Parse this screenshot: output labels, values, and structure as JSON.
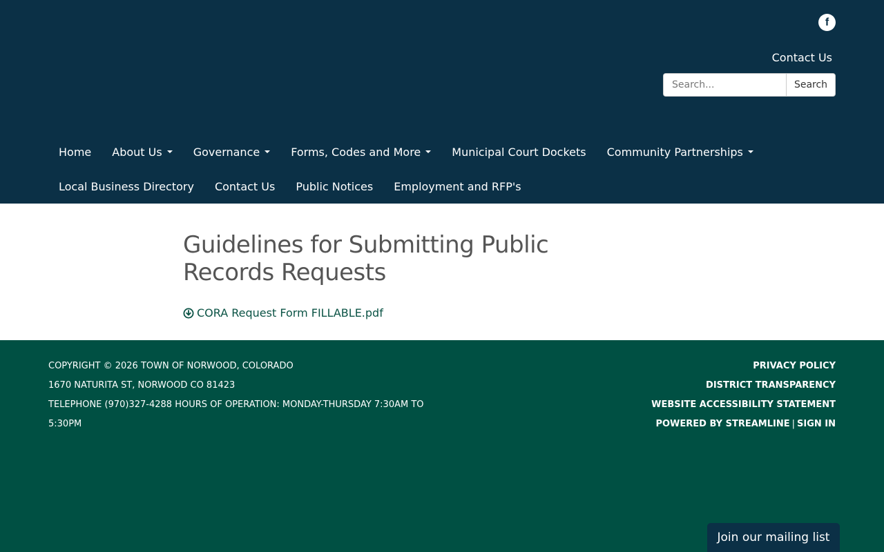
{
  "header": {
    "social": {
      "icon": "facebook-icon",
      "glyph": "f"
    },
    "contact_link": "Contact Us",
    "search": {
      "placeholder": "Search...",
      "button_label": "Search"
    }
  },
  "nav": {
    "row1": [
      {
        "label": "Home",
        "dropdown": false
      },
      {
        "label": "About Us",
        "dropdown": true
      },
      {
        "label": "Governance",
        "dropdown": true
      },
      {
        "label": "Forms, Codes and More",
        "dropdown": true
      },
      {
        "label": "Municipal Court Dockets",
        "dropdown": false
      },
      {
        "label": "Community Partnerships",
        "dropdown": true
      }
    ],
    "row2": [
      {
        "label": "Local Business Directory",
        "dropdown": false
      },
      {
        "label": "Contact Us",
        "dropdown": false
      },
      {
        "label": "Public Notices",
        "dropdown": false
      },
      {
        "label": "Employment and RFP's",
        "dropdown": false
      }
    ]
  },
  "main": {
    "title": "Guidelines for Submitting Public Records Requests",
    "attachment": {
      "icon": "download-circle-icon",
      "label": "CORA Request Form FILLABLE.pdf"
    }
  },
  "footer": {
    "copyright": "Copyright © 2026 Town of Norwood, Colorado",
    "address": "1670 Naturita St, Norwood CO 81423",
    "phone_hours": "Telephone (970)327-4288 Hours of Operation: Monday-Thursday 7:30am to 5:30pm",
    "links": {
      "privacy": "Privacy Policy",
      "transparency": "District Transparency",
      "accessibility": "Website Accessibility Statement",
      "powered": "Powered by Streamline",
      "separator": "|",
      "sign_in": "Sign In"
    }
  },
  "mailing_list": {
    "label": "Join our mailing list"
  },
  "colors": {
    "header_bg": "#0b3046",
    "footer_bg": "#005043",
    "title_text": "#555555",
    "link_text": "#0b5345"
  }
}
